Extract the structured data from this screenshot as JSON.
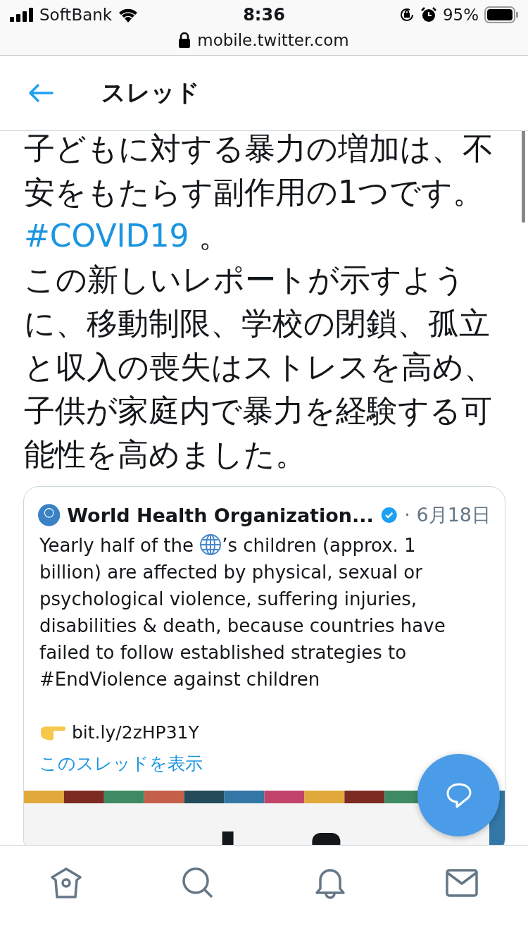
{
  "status_bar": {
    "carrier": "SoftBank",
    "time": "8:36",
    "battery": "95%"
  },
  "url_bar": {
    "address": "mobile.twitter.com"
  },
  "header": {
    "title": "スレッド"
  },
  "tweet": {
    "text_before": "子どもに対する暴力の増加は、不安をもたらす副作用の1つです。",
    "hashtag": "#COVID19",
    "text_after": " 。",
    "body": "この新しいレポートが示すように、移動制限、学校の閉鎖、孤立と収入の喪失はストレスを高め、子供が家庭内で暴力を経験する可能性を高めました。"
  },
  "quoted_tweet": {
    "author": "World Health Organization...",
    "verified": true,
    "date": "· 6月18日",
    "text_start": "Yearly half of the",
    "text_end": "’s children (approx. 1 billion) are affected by physical, sexual or psychological violence, suffering injuries, disabilities & death, because countries have failed to follow established strategies to #EndViolence against children",
    "link": "bit.ly/2zHP31Y",
    "show_thread": "このスレッドを表示"
  },
  "bottom_nav": [
    {
      "kind": "home",
      "selected": false
    },
    {
      "kind": "search",
      "selected": false
    },
    {
      "kind": "notifications",
      "selected": false
    },
    {
      "kind": "messages",
      "selected": false
    }
  ]
}
